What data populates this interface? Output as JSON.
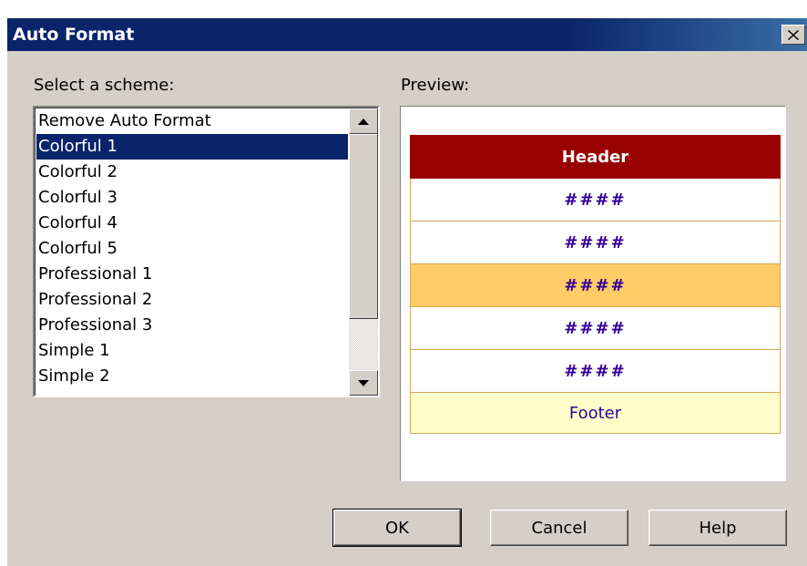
{
  "window": {
    "title": "Auto Format",
    "close_glyph": "✕"
  },
  "scheme_panel": {
    "label": "Select a scheme:",
    "items": [
      "Remove Auto Format",
      "Colorful 1",
      "Colorful 2",
      "Colorful 3",
      "Colorful 4",
      "Colorful 5",
      "Professional 1",
      "Professional 2",
      "Professional 3",
      "Simple 1",
      "Simple 2"
    ],
    "selected": "Colorful 1"
  },
  "preview_panel": {
    "label": "Preview:",
    "header": "Header",
    "rows": [
      "####",
      "####",
      "####",
      "####",
      "####"
    ],
    "footer": "Footer",
    "colors": {
      "header_bg": "#990000",
      "alt_row_bg": "#ffcc66",
      "footer_bg": "#ffffcc",
      "text": "#330099"
    }
  },
  "buttons": {
    "ok": "OK",
    "cancel": "Cancel",
    "help": "Help"
  }
}
